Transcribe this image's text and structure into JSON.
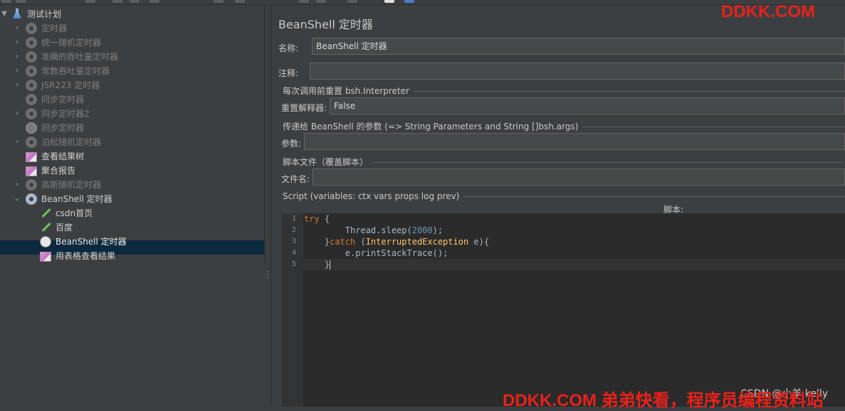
{
  "tree": {
    "root": {
      "label": "测试计划",
      "icon": "flask-icon"
    },
    "items": [
      {
        "label": "定时器",
        "icon": "gear-icon",
        "expandable": true,
        "disabled": true
      },
      {
        "label": "统一随机定时器",
        "icon": "gear-icon",
        "expandable": true,
        "disabled": true
      },
      {
        "label": "准确的吞吐量定时器",
        "icon": "gear-icon",
        "expandable": true,
        "disabled": true
      },
      {
        "label": "常数吞吐量定时器",
        "icon": "gear-icon",
        "expandable": true,
        "disabled": true
      },
      {
        "label": "JSR223 定时器",
        "icon": "gear-icon",
        "expandable": true,
        "disabled": true
      },
      {
        "label": "同步定时器",
        "icon": "gear-icon",
        "expandable": false,
        "disabled": true
      },
      {
        "label": "同步定时器2",
        "icon": "gear-icon",
        "expandable": true,
        "disabled": true
      },
      {
        "label": "同步定时器",
        "icon": "clock-icon",
        "expandable": false,
        "disabled": true
      },
      {
        "label": "泊松随机定时器",
        "icon": "gear-icon",
        "expandable": true,
        "disabled": true
      },
      {
        "label": "查看结果树",
        "icon": "chart-icon",
        "expandable": false,
        "disabled": false
      },
      {
        "label": "聚合报告",
        "icon": "chart-icon",
        "expandable": false,
        "disabled": false
      },
      {
        "label": "高斯随机定时器",
        "icon": "gear-icon",
        "expandable": true,
        "disabled": true
      },
      {
        "label": "BeanShell 定时器",
        "icon": "gear-icon",
        "expandable": true,
        "expanded": true,
        "disabled": false
      },
      {
        "label": "csdn首页",
        "icon": "pipette-icon",
        "disabled": false
      },
      {
        "label": "百度",
        "icon": "pipette-icon",
        "disabled": false
      },
      {
        "label": "BeanShell 定时器",
        "icon": "clock-icon",
        "disabled": false,
        "selected": true
      },
      {
        "label": "用表格查看结果",
        "icon": "chart-icon",
        "disabled": false
      }
    ]
  },
  "panel": {
    "title": "BeanShell 定时器",
    "name_label": "名称:",
    "name_value": "BeanShell 定时器",
    "comment_label": "注释:",
    "comment_value": "",
    "reset_section": "每次调用前重置 bsh.Interpreter",
    "reset_label": "重置解释器:",
    "reset_value": "False",
    "params_section": "传递给 BeanShell 的参数 (=> String Parameters and String []bsh.args)",
    "params_label": "参数:",
    "params_value": "",
    "file_section": "脚本文件（覆盖脚本）",
    "file_label": "文件名:",
    "file_value": "",
    "script_section": "Script (variables: ctx vars props log prev)",
    "script_label": "脚本:"
  },
  "editor": {
    "line_numbers": [
      "1",
      "2",
      "3",
      "4",
      "5"
    ],
    "lines": [
      [
        "try",
        " {"
      ],
      [
        "        Thread.sleep(",
        "2000",
        ");"
      ],
      [
        "    }",
        "catch",
        " (",
        "InterruptedException",
        " e){"
      ],
      [
        "        e.printStackTrace();"
      ],
      [
        "    }"
      ]
    ]
  },
  "watermarks": {
    "top": "DDKK.COM",
    "bottom": "DDKK.COM 弟弟快看，程序员编程资料站",
    "csdn": "CSDN @小羊 kelly"
  },
  "colors": {
    "background": "#3c3f41",
    "editor_bg": "#2b2b2b",
    "keyword": "#cc7832",
    "class": "#ffc66d",
    "number": "#6897bb",
    "watermark": "#e8221b",
    "selection": "#0d293e"
  }
}
